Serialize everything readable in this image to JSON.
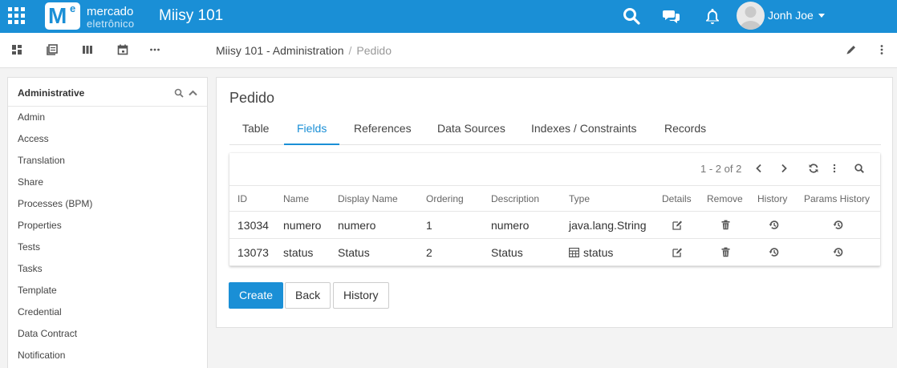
{
  "topbar": {
    "logo_line1": "mercado",
    "logo_line2": "eletrônico",
    "logo_mark": "M",
    "logo_mark_sup": "e",
    "app_title": "Miisy 101",
    "user_name": "Jonh Joe",
    "icons": [
      "apps-grid-icon",
      "search-icon",
      "chat-icon",
      "bell-icon",
      "user-avatar",
      "caret-down-icon"
    ],
    "brand_color": "#1a8fd6"
  },
  "subbar": {
    "icons": [
      "dashboard-icon",
      "pages-icon",
      "columns-icon",
      "calendar-icon",
      "more-horizontal-icon",
      "edit-icon",
      "more-vertical-icon"
    ],
    "breadcrumb": {
      "parent": "Miisy 101 - Administration",
      "separator": "/",
      "current": "Pedido"
    }
  },
  "sidebar": {
    "title": "Administrative",
    "items": [
      {
        "label": "Admin"
      },
      {
        "label": "Access"
      },
      {
        "label": "Translation"
      },
      {
        "label": "Share"
      },
      {
        "label": "Processes (BPM)"
      },
      {
        "label": "Properties"
      },
      {
        "label": "Tests"
      },
      {
        "label": "Tasks"
      },
      {
        "label": "Template"
      },
      {
        "label": "Credential"
      },
      {
        "label": "Data Contract"
      },
      {
        "label": "Notification"
      }
    ]
  },
  "main": {
    "title": "Pedido",
    "tabs": [
      {
        "label": "Table"
      },
      {
        "label": "Fields",
        "active": true
      },
      {
        "label": "References"
      },
      {
        "label": "Data Sources"
      },
      {
        "label": "Indexes / Constraints"
      },
      {
        "label": "Records"
      }
    ],
    "table": {
      "pager": "1 - 2 of 2",
      "columns": [
        "ID",
        "Name",
        "Display Name",
        "Ordering",
        "Description",
        "Type",
        "Details",
        "Remove",
        "History",
        "Params History"
      ],
      "rows": [
        {
          "id": "13034",
          "name": "numero",
          "display_name": "numero",
          "ordering": "1",
          "description": "numero",
          "type": "java.lang.String",
          "type_icon": ""
        },
        {
          "id": "13073",
          "name": "status",
          "display_name": "Status",
          "ordering": "2",
          "description": "Status",
          "type": "status",
          "type_icon": "table-icon"
        }
      ]
    },
    "buttons": {
      "create": "Create",
      "back": "Back",
      "history": "History"
    }
  }
}
